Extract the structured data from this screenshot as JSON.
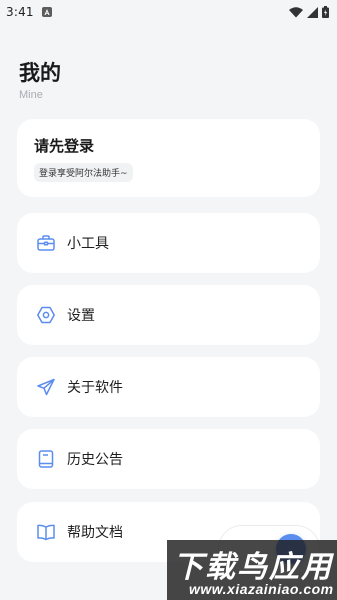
{
  "status_bar": {
    "time": "3:41",
    "notification_icon": "a-letter-icon",
    "icons": [
      "wifi-icon",
      "signal-icon",
      "battery-icon"
    ]
  },
  "header": {
    "title": "我的",
    "subtitle": "Mine"
  },
  "login_card": {
    "title": "请先登录",
    "hint": "登录享受阿尔法助手~"
  },
  "menu": [
    {
      "label": "小工具",
      "icon": "toolbox-icon"
    },
    {
      "label": "设置",
      "icon": "settings-hexagon-icon"
    },
    {
      "label": "关于软件",
      "icon": "paper-plane-icon"
    },
    {
      "label": "历史公告",
      "icon": "book-icon"
    },
    {
      "label": "帮助文档",
      "icon": "open-book-icon"
    }
  ],
  "colors": {
    "background": "#f4f5f7",
    "card": "#ffffff",
    "accent": "#5b8def"
  },
  "watermark": {
    "title": "下载鸟应用",
    "url": "www.xiazainiao.com"
  }
}
